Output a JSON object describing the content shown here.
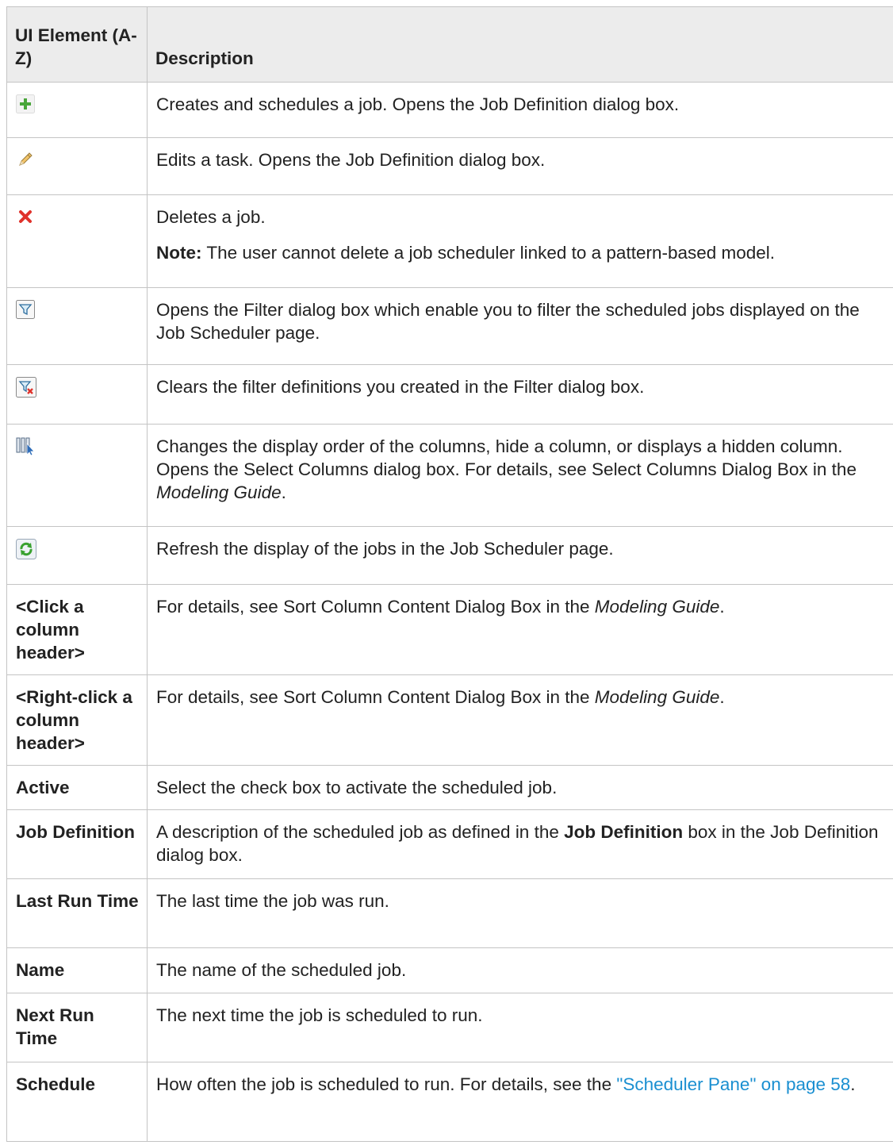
{
  "header": {
    "col1": "UI Element (A-Z)",
    "col2": "Description"
  },
  "rows": {
    "add": {
      "icon": "add-plus-icon",
      "desc": "Creates and schedules a job. Opens the Job Definition dialog box."
    },
    "edit": {
      "icon": "pencil-edit-icon",
      "desc": "Edits a task. Opens the Job Definition dialog box."
    },
    "delete": {
      "icon": "delete-x-icon",
      "desc": "Deletes a job.",
      "note_label": "Note:",
      "note_text": " The user cannot delete a job scheduler linked to a pattern-based model."
    },
    "filter": {
      "icon": "filter-funnel-icon",
      "desc": "Opens the Filter dialog box which enable you to filter the scheduled jobs displayed on the Job Scheduler page."
    },
    "clear": {
      "icon": "clear-filter-icon",
      "desc": "Clears the filter definitions you created in the Filter dialog box."
    },
    "columns": {
      "icon": "select-columns-icon",
      "desc_a": "Changes the display order of the columns, hide a column, or displays a hidden column. Opens the Select Columns dialog box. For details, see Select Columns Dialog Box in the ",
      "desc_guide": "Modeling Guide",
      "desc_b": "."
    },
    "refresh": {
      "icon": "refresh-icon",
      "desc": "Refresh the display of the jobs in the Job Scheduler page."
    },
    "click_header": {
      "element": "<Click a column header>",
      "desc_a": "For details, see Sort Column Content Dialog Box in the ",
      "desc_guide": "Modeling Guide",
      "desc_b": "."
    },
    "right_click_header": {
      "element": "<Right-click a column header>",
      "desc_a": "For details, see Sort Column Content Dialog Box in the ",
      "desc_guide": "Modeling Guide",
      "desc_b": "."
    },
    "active": {
      "element": "Active",
      "desc": "Select the check box to activate the scheduled job."
    },
    "job_def": {
      "element": "Job Definition",
      "desc_a": "A description of the scheduled job as defined in the ",
      "desc_bold": "Job Definition",
      "desc_b": " box in the Job Definition dialog box."
    },
    "last_run": {
      "element": "Last Run Time",
      "desc": "The last time the job was run."
    },
    "name": {
      "element": "Name",
      "desc": "The name of the scheduled job."
    },
    "next_run": {
      "element": "Next Run Time",
      "desc": "The next time the job is scheduled to run."
    },
    "schedule": {
      "element": "Schedule",
      "desc_a": "How often the job is scheduled to run. For details, see the ",
      "desc_link": "\"Scheduler Pane\" on page 58",
      "desc_b": "."
    }
  },
  "colors": {
    "header_bg": "#ececec",
    "border": "#c4c4c4",
    "link": "#1a8fd1",
    "add_green": "#49a63a",
    "delete_red": "#e0322b",
    "refresh_green": "#39a12f"
  }
}
